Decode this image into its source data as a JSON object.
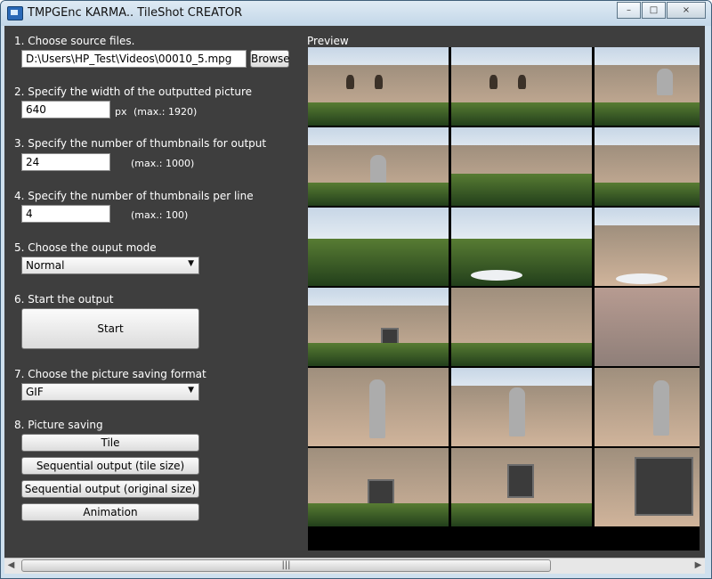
{
  "window": {
    "title": "TMPGEnc KARMA.. TileShot CREATOR",
    "minimize": "–",
    "maximize": "□",
    "close": "×"
  },
  "steps": {
    "source_label": "1. Choose source files.",
    "source_value": "D:\\Users\\HP_Test\\Videos\\00010_5.mpg",
    "browse": "Browse",
    "width_label": "2. Specify the width of the outputted picture",
    "width_value": "640",
    "width_unit": "px",
    "width_max": "(max.: 1920)",
    "thumbs_label": "3. Specify the number of thumbnails for output",
    "thumbs_value": "24",
    "thumbs_max": "(max.: 1000)",
    "per_line_label": "4. Specify the number of thumbnails per line",
    "per_line_value": "4",
    "per_line_max": "(max.: 100)",
    "mode_label": "5. Choose the ouput mode",
    "mode_value": "Normal",
    "start_label": "6. Start the output",
    "start_button": "Start",
    "format_label": "7. Choose the picture saving format",
    "format_value": "GIF",
    "saving_label": "8. Picture saving",
    "tile_button": "Tile",
    "seq_tile_button": "Sequential output (tile size)",
    "seq_original_button": "Sequential output (original size)",
    "animation_button": "Animation"
  },
  "preview": {
    "label": "Preview",
    "thumbnails": [
      "mission-arches",
      "mission-arches",
      "mission-bell-wall",
      "ruins-statue",
      "mission-wall-garden",
      "ruins-gardens",
      "garden-tree",
      "garden-table",
      "ruins-courtyard",
      "statue-plaque",
      "brick-wall",
      "stone-pavement",
      "statue-closeup",
      "statue-rear",
      "statue-front",
      "plaque-wall",
      "plaque-wall",
      "plaque-sign"
    ]
  },
  "scrollbar": {
    "left_arrow": "◀",
    "grip": "|||",
    "right_arrow": "▶"
  }
}
